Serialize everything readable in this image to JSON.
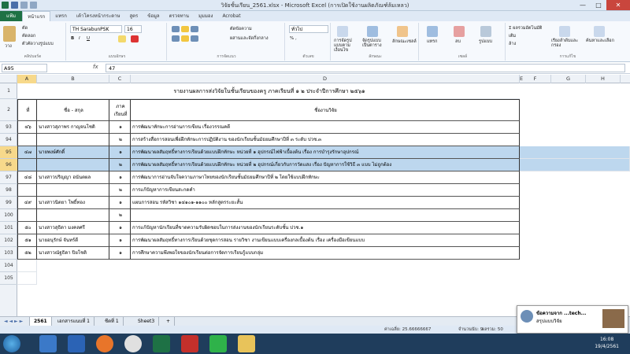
{
  "window": {
    "title": "วิจัยชั้นเรียน_2561.xlsx - Microsoft Excel (การเปิดใช้งานผลิตภัณฑ์ล้มเหลว)",
    "minimize": "—",
    "maximize": "□",
    "close": "✕"
  },
  "ribbon_tabs": [
    "แฟ้ม",
    "หน้าแรก",
    "แทรก",
    "เค้าโครงหน้ากระดาษ",
    "สูตร",
    "ข้อมูล",
    "ตรวจทาน",
    "มุมมอง",
    "Acrobat"
  ],
  "ribbon": {
    "paste_label": "วาง",
    "cut": "ตัด",
    "copy": "คัดลอก",
    "format_painter": "ตัวคัดวางรูปแบบ",
    "clipboard_label": "คลิปบอร์ด",
    "font_name": "TH SarabunPSK",
    "font_size": "16",
    "font_label": "แบบอักษร",
    "alignment_label": "การจัดแนว",
    "wrap_text": "ตัดข้อความ",
    "merge_center": "ผสานและจัดกึ่งกลาง",
    "number_format": "ทั่วไป",
    "number_label": "ตัวเลข",
    "conditional_format": "การจัดรูปแบบตามเงื่อนไข",
    "format_as_table": "จัดรูปแบบเป็นตาราง",
    "cell_styles": "ลักษณะเซลล์",
    "styles_label": "ลักษณะ",
    "insert": "แทรก",
    "delete": "ลบ",
    "format": "รูปแบบ",
    "cells_label": "เซลล์",
    "autosum": "ผลรวมอัตโนมัติ",
    "fill": "เติม",
    "clear": "ล้าง",
    "sort_filter": "เรียงลำดับและกรอง",
    "find_select": "ค้นหาและเลือก",
    "editing_label": "การแก้ไข"
  },
  "formula_bar": {
    "name_box": "A95",
    "fx": "fx",
    "value": "47"
  },
  "columns": [
    "A",
    "B",
    "C",
    "D",
    "E",
    "F",
    "G",
    "H"
  ],
  "table_title": "รายงานผลการส่งวิจัยในชั้นเรียนของครู ภาคเรียนที่ ๑ ๒ ประจำปีการศึกษา ๒๕๖๑",
  "table_headers": {
    "no": "ที่",
    "name": "ชื่อ - สกุล",
    "semester": "ภาคเรียนที่",
    "title": "ชื่องานวิจัย"
  },
  "rows": [
    {
      "rownum": "93",
      "no": "๔๖",
      "name": "นางสาวสุภาพร กาญจนโชติ",
      "sem": "๑",
      "title": "การพัฒนาทักษะการอ่านการเขียน เรื่องวรรณคดี"
    },
    {
      "rownum": "94",
      "no": "",
      "name": "",
      "sem": "๒",
      "title": "การสร้างสื่อการสอนเพื่อฝึกทักษะการปฏิบัติงาน ของนักเรียนชั้นมัธยมศึกษาปีที่ ๓ ระดับ ปวช.๓"
    },
    {
      "rownum": "95",
      "no": "๔๗",
      "name": "นายพงษ์ศักดิ์",
      "sem": "๑",
      "title": "การพัฒนาผลสัมฤทธิ์ทางการเรียนด้วยแบบฝึกทักษะ หน่วยที่ ๑ อุปกรณ์ไฟฟ้าเบื้องต้น เรื่อง การบำรุงรักษาอุปกรณ์"
    },
    {
      "rownum": "96",
      "no": "",
      "name": "",
      "sem": "๒",
      "title": "การพัฒนาผลสัมฤทธิ์ทางการเรียนด้วยแบบฝึกทักษะ หน่วยที่ ๒ อุปกรณ์เกี่ยวกับการวัดแสง เรื่อง ปัญหาการใช้วิธี ๓ แบบ ไม่ถูกต้อง"
    },
    {
      "rownum": "97",
      "no": "๔๘",
      "name": "นางสาวปริญญา อนันตผล",
      "sem": "๑",
      "title": "การพัฒนาการอ่านจับใจความภาษาไทยของนักเรียนชั้นมัธยมศึกษาปีที่ ๒ โดยใช้แบบฝึกทักษะ"
    },
    {
      "rownum": "98",
      "no": "",
      "name": "",
      "sem": "๒",
      "title": "การแก้ปัญหาการเขียนสะกดคำ"
    },
    {
      "rownum": "99",
      "no": "๔๙",
      "name": "นางสาวนิตยา โพธิ์ทอง",
      "sem": "๑",
      "title": "แผนการสอน รหัสวิชา ๑๔๑๐๑-๑๑๐๐ หลักสูตรระยะสั้น"
    },
    {
      "rownum": "100",
      "no": "",
      "name": "",
      "sem": "๒",
      "title": ""
    },
    {
      "rownum": "101",
      "no": "๕๐",
      "name": "นางสาวสุธิดา มงคลศรี",
      "sem": "๑",
      "title": "การแก้ปัญหานักเรียนที่ขาดความรับผิดชอบในการส่งงานของนักเรียนระดับชั้น ปวช.๑"
    },
    {
      "rownum": "102",
      "no": "๕๑",
      "name": "นายอนุรักษ์ จันทร์ดี",
      "sem": "๑",
      "title": "การพัฒนาผลสัมฤทธิ์ทางการเรียนด้วยชุดการสอน รายวิชา งานเขียนแบบเครื่องกลเบื้องต้น เรื่อง เครื่องมือเขียนแบบ"
    },
    {
      "rownum": "103",
      "no": "๕๒",
      "name": "นางสาวณัฐธิดา ปิยโชติ",
      "sem": "๑",
      "title": "การศึกษาความพึงพอใจของนักเรียนต่อการจัดการเรียนรู้แบบกลุ่ม"
    },
    {
      "rownum": "104",
      "no": "",
      "name": "",
      "sem": "",
      "title": ""
    },
    {
      "rownum": "105",
      "no": "",
      "name": "",
      "sem": "",
      "title": ""
    }
  ],
  "sheet_tabs": [
    "2561",
    "เอกสารแนบที่ 1",
    "ชีตที่ 1",
    "Sheet3"
  ],
  "status": {
    "average": "ค่าเฉลี่ย: 25.66666667",
    "count": "จำนวนนับ: 9",
    "sum": "ผลรวม: 50"
  },
  "notification": {
    "title": "ข้อความจาก ...tech...",
    "body": "สรุปแบบวิจัย"
  },
  "clock": {
    "time": "16:08",
    "date": "19/4/2561"
  },
  "colors": {
    "excel_green": "#1e7145",
    "selection": "#bdd7ee",
    "taskbar": "#1f3d5c"
  }
}
